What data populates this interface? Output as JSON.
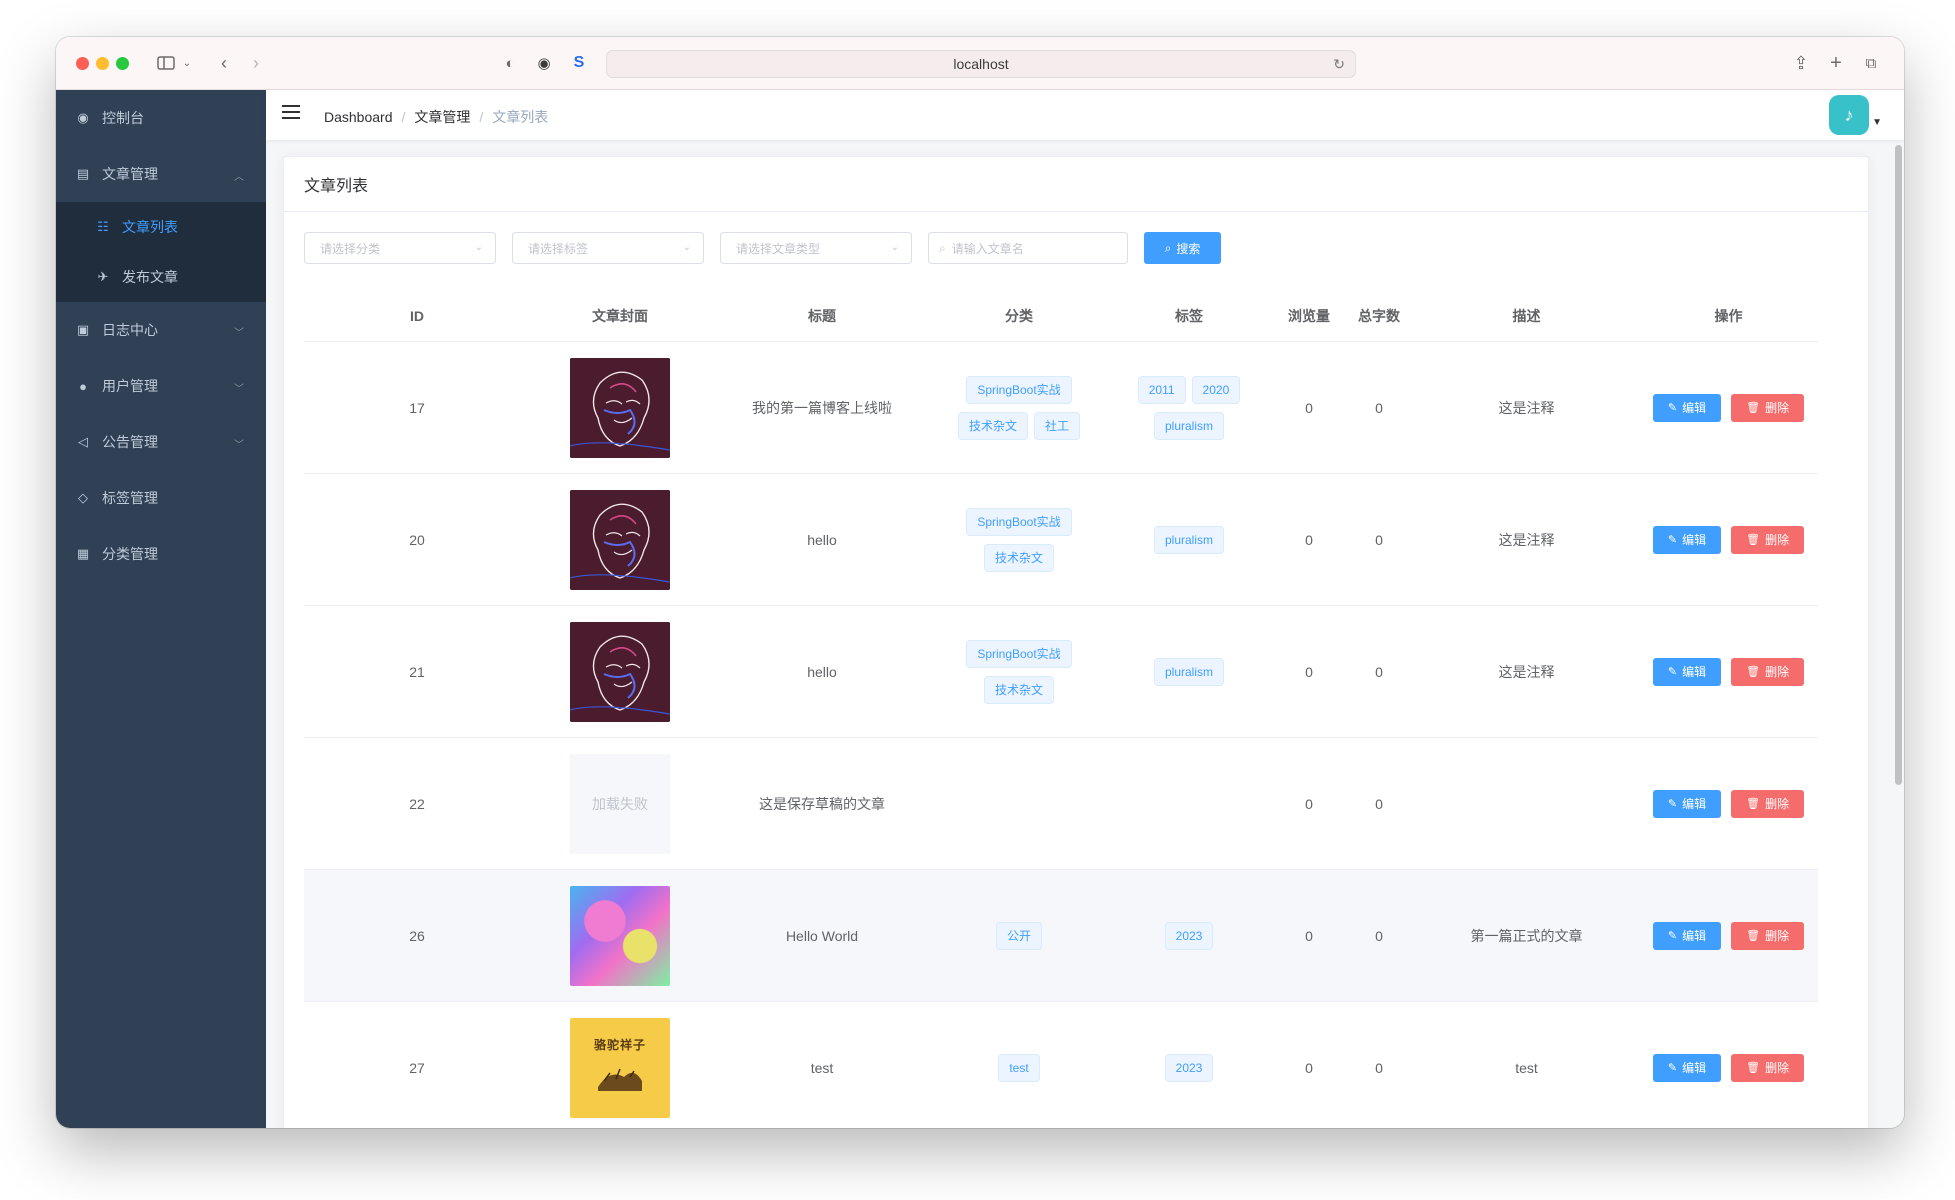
{
  "browser": {
    "url": "localhost"
  },
  "sidebar": {
    "items": [
      {
        "label": "控制台",
        "icon": "dashboard-icon",
        "glyph": "◉"
      },
      {
        "label": "文章管理",
        "icon": "document-icon",
        "glyph": "▤",
        "expanded": true,
        "children": [
          {
            "label": "文章列表",
            "icon": "list-icon",
            "glyph": "☷",
            "active": true
          },
          {
            "label": "发布文章",
            "icon": "send-icon",
            "glyph": "✈"
          }
        ]
      },
      {
        "label": "日志中心",
        "icon": "log-icon",
        "glyph": "▣"
      },
      {
        "label": "用户管理",
        "icon": "user-icon",
        "glyph": "●"
      },
      {
        "label": "公告管理",
        "icon": "speaker-icon",
        "glyph": "◁"
      },
      {
        "label": "标签管理",
        "icon": "tag-icon",
        "glyph": "◇"
      },
      {
        "label": "分类管理",
        "icon": "grid-icon",
        "glyph": "▦"
      }
    ]
  },
  "breadcrumb": {
    "items": [
      "Dashboard",
      "文章管理",
      "文章列表"
    ]
  },
  "card": {
    "title": "文章列表"
  },
  "filters": {
    "category_placeholder": "请选择分类",
    "tag_placeholder": "请选择标签",
    "type_placeholder": "请选择文章类型",
    "name_placeholder": "请输入文章名",
    "search_label": "搜索"
  },
  "table": {
    "headers": {
      "id": "ID",
      "cover": "文章封面",
      "title": "标题",
      "category": "分类",
      "tags": "标签",
      "views": "浏览量",
      "words": "总字数",
      "desc": "描述",
      "ops": "操作"
    },
    "edit_label": "编辑",
    "delete_label": "删除",
    "cover_error_text": "加载失败",
    "rows": [
      {
        "id": "17",
        "cover": "portrait",
        "title": "我的第一篇博客上线啦",
        "categories": [
          "SpringBoot实战",
          "技术杂文",
          "社工"
        ],
        "tags": [
          "2011",
          "2020",
          "pluralism"
        ],
        "views": "0",
        "words": "0",
        "desc": "这是注释",
        "highlight": false
      },
      {
        "id": "20",
        "cover": "portrait",
        "title": "hello",
        "categories": [
          "SpringBoot实战",
          "技术杂文"
        ],
        "tags": [
          "pluralism"
        ],
        "views": "0",
        "words": "0",
        "desc": "这是注释",
        "highlight": false
      },
      {
        "id": "21",
        "cover": "portrait",
        "title": "hello",
        "categories": [
          "SpringBoot实战",
          "技术杂文"
        ],
        "tags": [
          "pluralism"
        ],
        "views": "0",
        "words": "0",
        "desc": "这是注释",
        "highlight": false
      },
      {
        "id": "22",
        "cover": "error",
        "title": "这是保存草稿的文章",
        "categories": [],
        "tags": [],
        "views": "0",
        "words": "0",
        "desc": "",
        "highlight": false
      },
      {
        "id": "26",
        "cover": "gradient",
        "title": "Hello World",
        "categories": [
          "公开"
        ],
        "tags": [
          "2023"
        ],
        "views": "0",
        "words": "0",
        "desc": "第一篇正式的文章",
        "highlight": true
      },
      {
        "id": "27",
        "cover": "book",
        "title": "test",
        "categories": [
          "test"
        ],
        "tags": [
          "2023"
        ],
        "views": "0",
        "words": "0",
        "desc": "test",
        "highlight": false
      }
    ]
  },
  "colors": {
    "primary": "#409eff",
    "danger": "#f56c6c",
    "sidebar_bg": "#304156",
    "submenu_bg": "#1f2d3d"
  }
}
